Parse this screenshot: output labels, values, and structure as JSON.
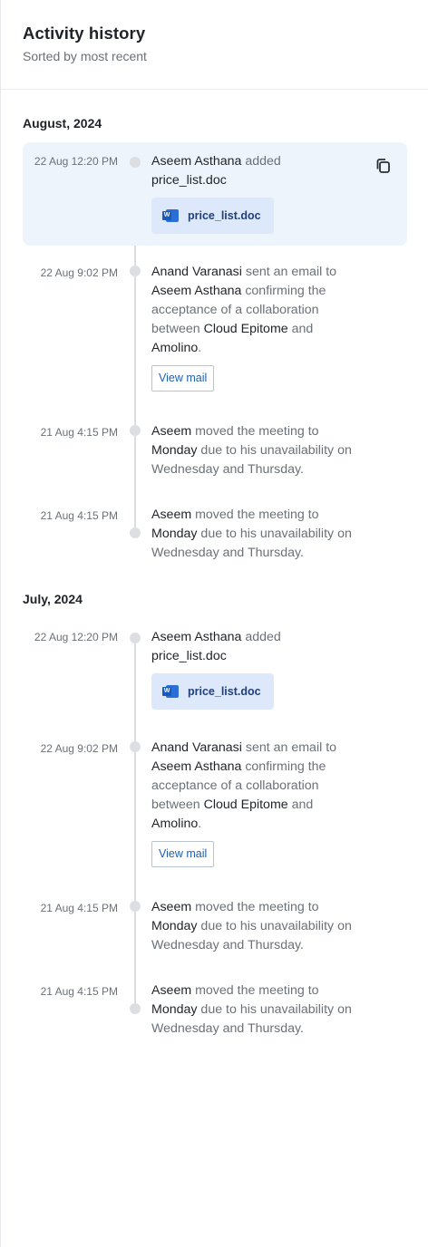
{
  "header": {
    "title": "Activity history",
    "subtitle": "Sorted by most recent"
  },
  "sections": [
    {
      "month": "August, 2024",
      "items": [
        {
          "time": "22 Aug 12:20 PM",
          "actor": "Aseem Asthana",
          "action": " added",
          "object": "price_list.doc",
          "file": "price_list.doc",
          "copy_icon": "copy-icon"
        },
        {
          "time": "22 Aug 9:02 PM",
          "actor": "Anand Varanasi",
          "t1": " sent an email to",
          "recipient": "Aseem Asthana",
          "t2": " confirming the acceptance of a collaboration between ",
          "org1": "Cloud Epitome",
          "t3": " and ",
          "org2": "Amolino",
          "t4": ".",
          "button": "View mail"
        },
        {
          "time": "21 Aug 4:15 PM",
          "actor": "Aseem",
          "t1": " moved the meeting to ",
          "day": "Monday",
          "t2": " due to his unavailability on Wednesday and Thursday."
        },
        {
          "time": "21 Aug 4:15 PM",
          "actor": "Aseem",
          "t1": " moved the meeting to ",
          "day": "Monday",
          "t2": " due to his unavailability on Wednesday and Thursday."
        }
      ]
    },
    {
      "month": "July, 2024",
      "items": [
        {
          "time": "22 Aug 12:20 PM",
          "actor": "Aseem Asthana",
          "action": " added",
          "object": "price_list.doc",
          "file": "price_list.doc"
        },
        {
          "time": "22 Aug 9:02 PM",
          "actor": "Anand Varanasi",
          "t1": " sent an email to",
          "recipient": "Aseem Asthana",
          "t2": " confirming the acceptance of a collaboration between ",
          "org1": "Cloud Epitome",
          "t3": " and ",
          "org2": "Amolino",
          "t4": ".",
          "button": "View mail"
        },
        {
          "time": "21 Aug 4:15 PM",
          "actor": "Aseem",
          "t1": " moved the meeting to ",
          "day": "Monday",
          "t2": " due to his unavailability on Wednesday and Thursday."
        },
        {
          "time": "21 Aug 4:15 PM",
          "actor": "Aseem",
          "t1": " moved the meeting to ",
          "day": "Monday",
          "t2": " due to his unavailability on Wednesday and Thursday."
        }
      ]
    }
  ],
  "file_icon": "word-document-icon"
}
